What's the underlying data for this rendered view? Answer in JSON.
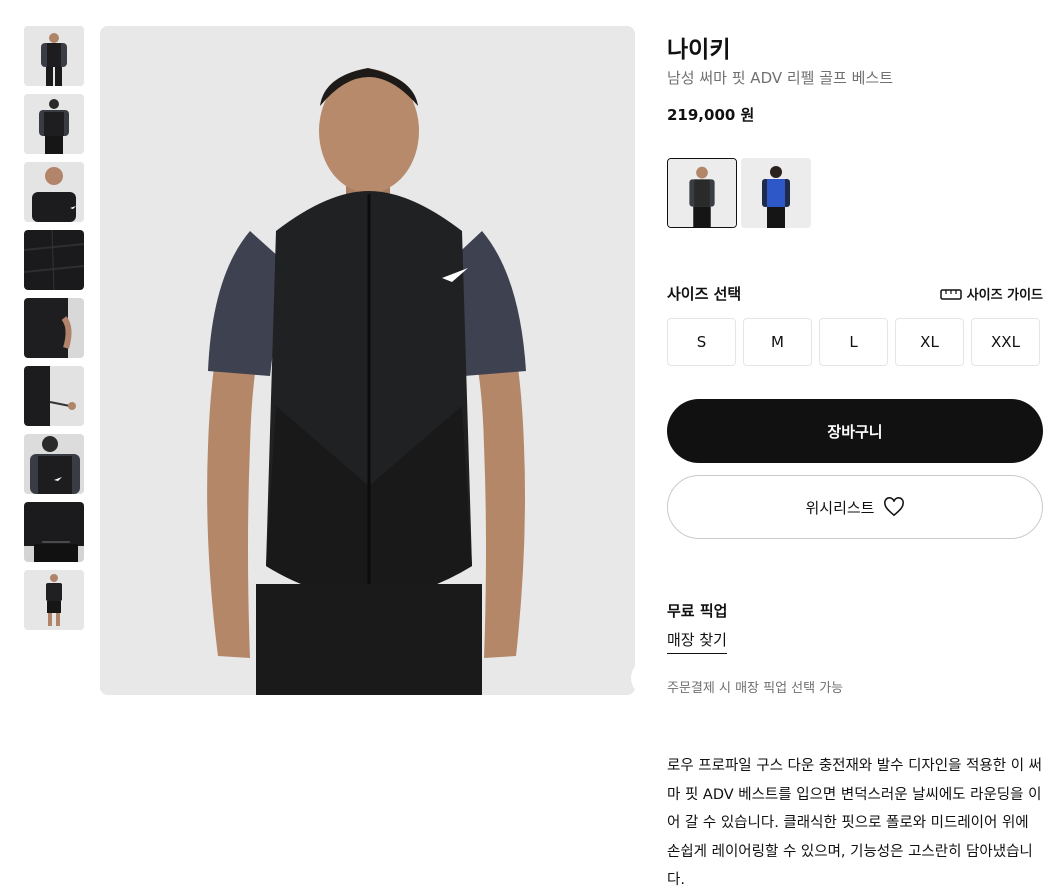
{
  "product": {
    "brand": "나이키",
    "subtitle": "남성 써마 핏 ADV 리펠 골프 베스트",
    "price": "219,000 원"
  },
  "gallery": {
    "thumbnails": [
      {
        "icon": "model-front-thumbnail"
      },
      {
        "icon": "model-back-thumbnail"
      },
      {
        "icon": "collar-side-thumbnail"
      },
      {
        "icon": "fabric-detail-thumbnail"
      },
      {
        "icon": "pocket-detail-thumbnail"
      },
      {
        "icon": "hem-adjuster-thumbnail"
      },
      {
        "icon": "back-logo-thumbnail"
      },
      {
        "icon": "back-hem-thumbnail"
      },
      {
        "icon": "full-body-thumbnail"
      }
    ],
    "prev_icon": "chevron-left-icon",
    "next_icon": "chevron-right-icon"
  },
  "colorways": [
    {
      "icon": "black-vest-colorway",
      "color": "#2a2a2a",
      "selected": true
    },
    {
      "icon": "blue-vest-colorway",
      "color": "#2e58c8",
      "selected": false
    }
  ],
  "sizes": {
    "title": "사이즈 선택",
    "guide_label": "사이즈 가이드",
    "guide_icon": "ruler-icon",
    "options": [
      "S",
      "M",
      "L",
      "XL",
      "XXL"
    ]
  },
  "actions": {
    "cart_label": "장바구니",
    "wishlist_label": "위시리스트",
    "wishlist_icon": "heart-icon"
  },
  "pickup": {
    "title": "무료 픽업",
    "store_link": "매장 찾기",
    "note": "주문결제 시 매장 픽업 선택 가능"
  },
  "description": "로우 프로파일 구스 다운 충전재와 발수 디자인을 적용한 이 써마 핏 ADV 베스트를 입으면 변덕스러운 날씨에도 라운딩을 이어 갈 수 있습니다. 클래식한 핏으로 폴로와 미드레이어 위에 손쉽게 레이어링할 수 있으며, 기능성은 고스란히 담아냈습니다.",
  "colors": {
    "text_primary": "#111111",
    "text_secondary": "#707072",
    "button_dark": "#111111",
    "image_background": "#e8e8e8",
    "border": "#e5e5e5"
  }
}
